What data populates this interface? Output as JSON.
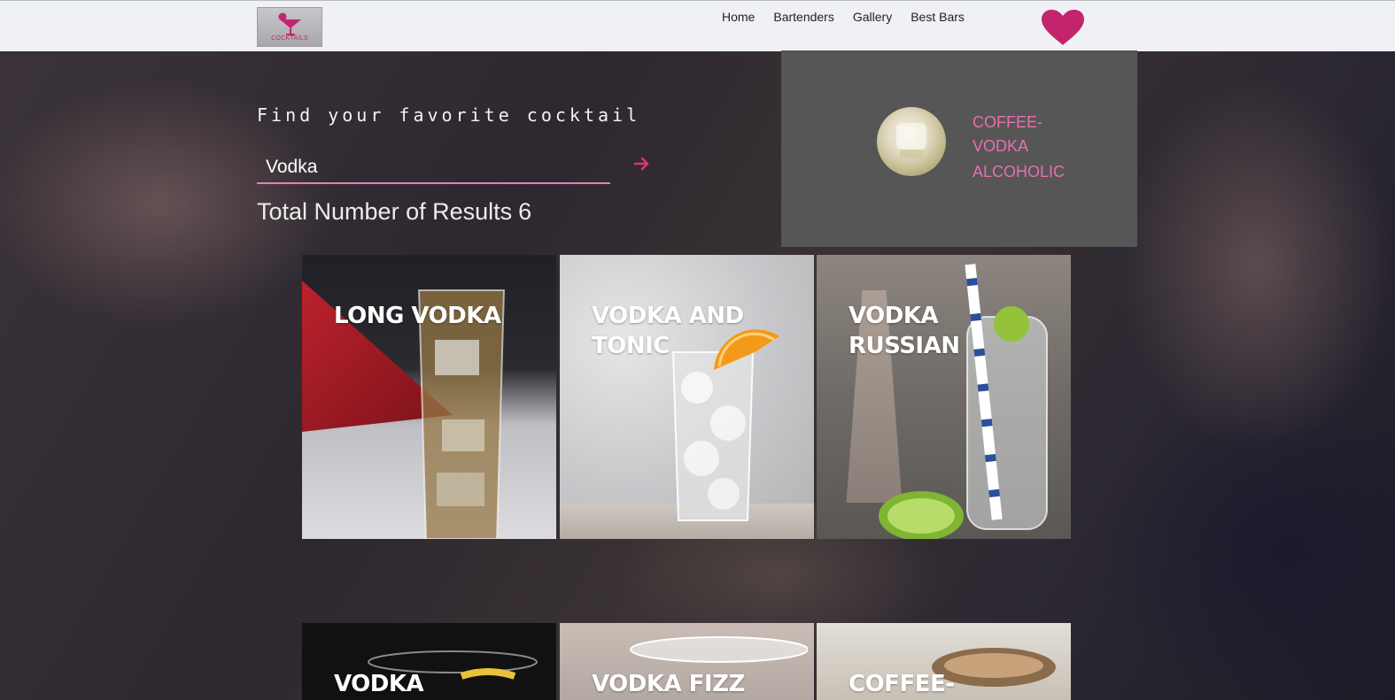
{
  "header": {
    "logo_text": "COCKTAILS",
    "nav": [
      "Home",
      "Bartenders",
      "Gallery",
      "Best Bars"
    ],
    "accent_color": "#c4236e"
  },
  "favorites": {
    "name": "COFFEE-VODKA",
    "type": "ALCOHOLIC"
  },
  "search": {
    "title": "Find your favorite cocktail",
    "value": "Vodka",
    "results_label": "Total Number of Results",
    "results_count": "6"
  },
  "cards": [
    {
      "title": "LONG VODKA"
    },
    {
      "title": "VODKA AND TONIC"
    },
    {
      "title": "VODKA RUSSIAN"
    },
    {
      "title": "VODKA"
    },
    {
      "title": "VODKA FIZZ"
    },
    {
      "title": "COFFEE-"
    }
  ]
}
